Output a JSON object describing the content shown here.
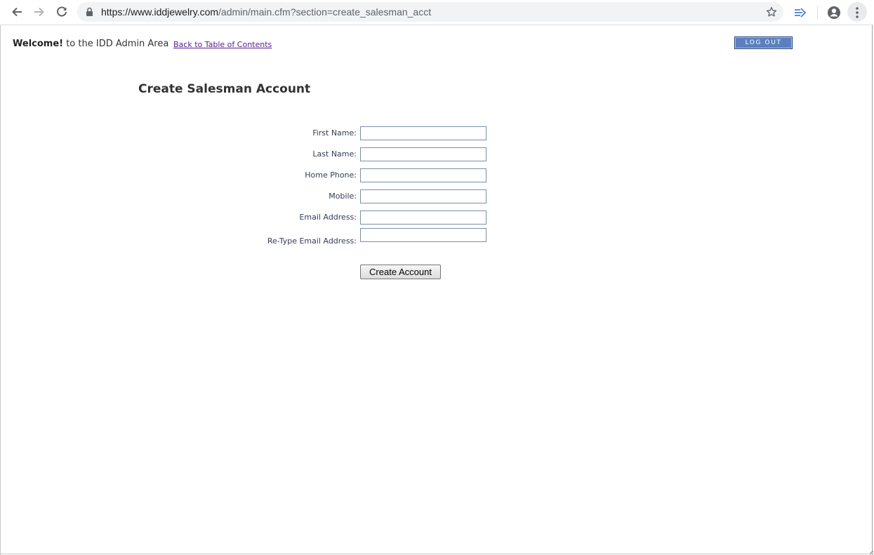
{
  "browser": {
    "url_host": "https://www.iddjewelry.com",
    "url_path": "/admin/main.cfm?section=create_salesman_acct"
  },
  "header": {
    "welcome_bold": "Welcome!",
    "welcome_rest": " to the IDD Admin Area",
    "back_link": "Back to Table of Contents",
    "logout_label": "LOG OUT"
  },
  "page": {
    "title": "Create Salesman Account"
  },
  "form": {
    "fields": [
      {
        "label": "First Name:",
        "value": ""
      },
      {
        "label": "Last Name:",
        "value": ""
      },
      {
        "label": "Home Phone:",
        "value": ""
      },
      {
        "label": "Mobile:",
        "value": ""
      },
      {
        "label": "Email Address:",
        "value": ""
      },
      {
        "label": "Re-Type Email Address:",
        "value": ""
      }
    ],
    "submit_label": "Create Account"
  },
  "icons": {
    "back": "arrow-left-icon",
    "forward": "arrow-right-icon",
    "reload": "reload-icon",
    "lock": "lock-icon",
    "bookmark": "star-icon",
    "extension": "extension-arrow-icon",
    "profile": "account-circle-icon",
    "menu": "kebab-menu-icon"
  },
  "colors": {
    "logout_bg": "#5b7fbf",
    "link_visited": "#551a8b",
    "field_border": "#7a8fa6"
  }
}
